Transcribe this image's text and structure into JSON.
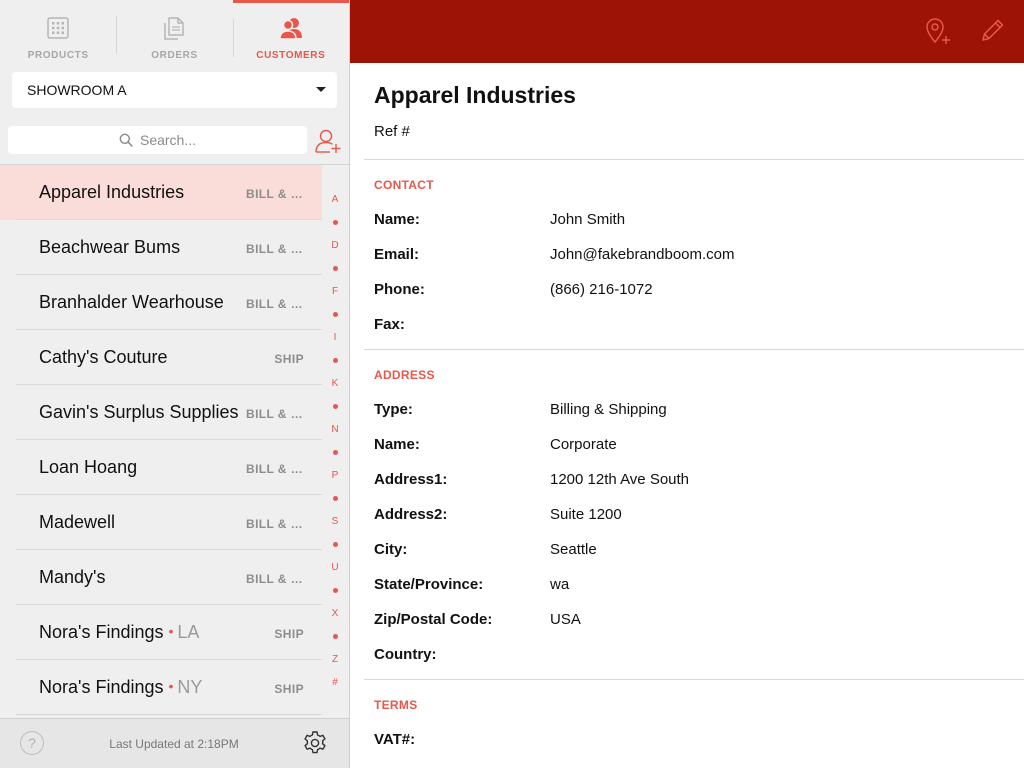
{
  "tabs": [
    {
      "label": "PRODUCTS",
      "icon": "grid-icon",
      "active": false
    },
    {
      "label": "ORDERS",
      "icon": "documents-icon",
      "active": false
    },
    {
      "label": "CUSTOMERS",
      "icon": "users-icon",
      "active": true
    }
  ],
  "showroom": {
    "selected": "SHOWROOM A"
  },
  "search": {
    "placeholder": "Search..."
  },
  "customers": [
    {
      "name": "Apparel Industries",
      "location": "",
      "type": "BILL & SHIP",
      "selected": true
    },
    {
      "name": "Beachwear Bums",
      "location": "",
      "type": "BILL & SHIP"
    },
    {
      "name": "Branhalder Wearhouse",
      "location": "",
      "type": "BILL & SHIP"
    },
    {
      "name": "Cathy's Couture",
      "location": "",
      "type": "SHIP"
    },
    {
      "name": "Gavin's Surplus Supplies",
      "location": "",
      "type": "BILL & SHIP"
    },
    {
      "name": "Loan Hoang",
      "location": "",
      "type": "BILL & SHIP"
    },
    {
      "name": "Madewell",
      "location": "",
      "type": "BILL & SHIP"
    },
    {
      "name": "Mandy's",
      "location": "",
      "type": "BILL & SHIP"
    },
    {
      "name": "Nora's Findings",
      "location": "LA",
      "type": "SHIP"
    },
    {
      "name": "Nora's Findings",
      "location": "NY",
      "type": "SHIP"
    }
  ],
  "index": [
    "A",
    "•",
    "D",
    "•",
    "F",
    "•",
    "I",
    "•",
    "K",
    "•",
    "N",
    "•",
    "P",
    "•",
    "S",
    "•",
    "U",
    "•",
    "X",
    "•",
    "Z",
    "#"
  ],
  "footer": {
    "updated": "Last Updated at 2:18PM",
    "help": "?"
  },
  "detail": {
    "title": "Apparel Industries",
    "ref": "Ref #",
    "contact": {
      "heading": "CONTACT",
      "fields": [
        {
          "label": "Name:",
          "value": "John Smith"
        },
        {
          "label": "Email:",
          "value": "John@fakebrandboom.com"
        },
        {
          "label": "Phone:",
          "value": "(866) 216-1072"
        },
        {
          "label": "Fax:",
          "value": ""
        }
      ]
    },
    "address": {
      "heading": "ADDRESS",
      "fields": [
        {
          "label": "Type:",
          "value": "Billing & Shipping"
        },
        {
          "label": "Name:",
          "value": "Corporate"
        },
        {
          "label": "Address1:",
          "value": "1200 12th Ave South"
        },
        {
          "label": "Address2:",
          "value": "Suite 1200"
        },
        {
          "label": "City:",
          "value": "Seattle"
        },
        {
          "label": "State/Province:",
          "value": "wa"
        },
        {
          "label": "Zip/Postal Code:",
          "value": "USA"
        },
        {
          "label": "Country:",
          "value": ""
        }
      ]
    },
    "terms": {
      "heading": "TERMS",
      "fields": [
        {
          "label": "VAT#:",
          "value": ""
        }
      ]
    }
  },
  "colors": {
    "accent": "#e8574b",
    "topbar": "#9d1407",
    "selected_row": "#fadcd8"
  }
}
